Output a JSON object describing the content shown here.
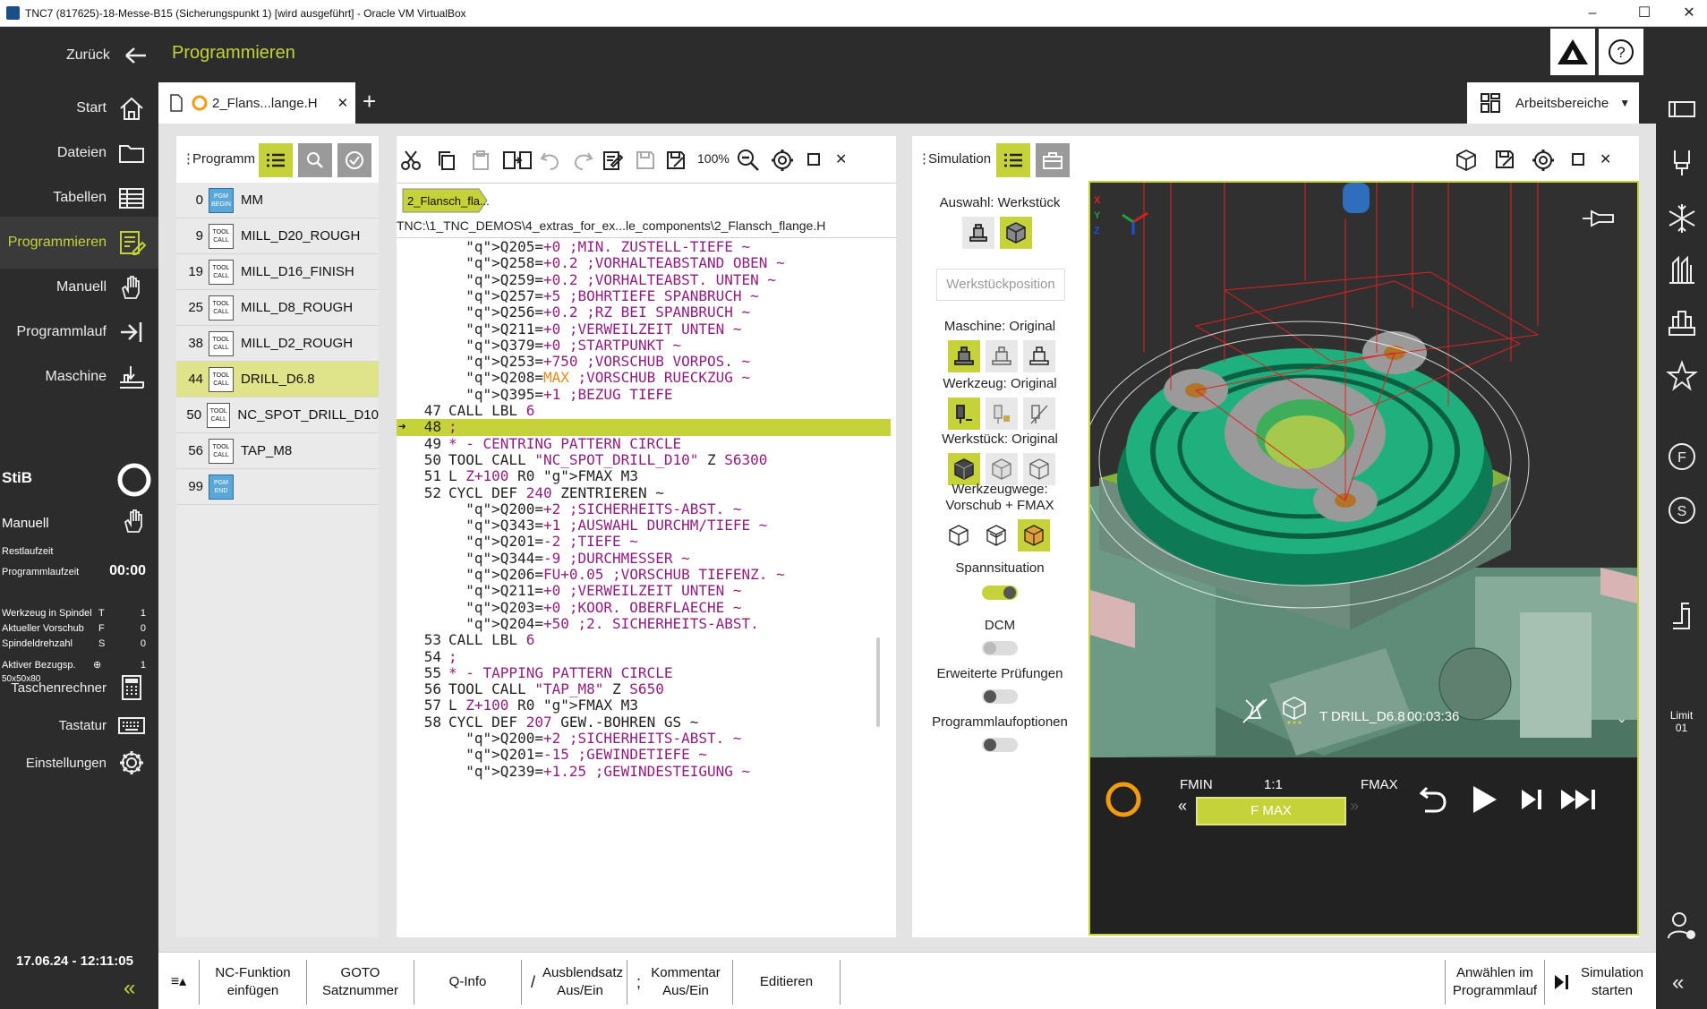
{
  "window": {
    "title": "TNC7 (817625)-18-Messe-B15 (Sicherungspunkt 1) [wird ausgeführt] - Oracle VM VirtualBox"
  },
  "header": {
    "back_label": "Zurück",
    "page_title": "Programmieren"
  },
  "nav": {
    "items": [
      {
        "label": "Start",
        "icon": "home-icon"
      },
      {
        "label": "Dateien",
        "icon": "folder-icon"
      },
      {
        "label": "Tabellen",
        "icon": "table-icon"
      },
      {
        "label": "Programmieren",
        "icon": "program-edit-icon",
        "active": true
      },
      {
        "label": "Manuell",
        "icon": "hand-icon"
      },
      {
        "label": "Programmlauf",
        "icon": "program-run-icon"
      },
      {
        "label": "Maschine",
        "icon": "machine-icon"
      }
    ],
    "stib_label": "StiB",
    "manuell_label": "Manuell",
    "restlaufzeit_label": "Restlaufzeit",
    "programmlaufzeit_label": "Programmlaufzeit",
    "programmlaufzeit_value": "00:00",
    "status": [
      {
        "label": "Werkzeug in Spindel",
        "sym": "T",
        "value": "1"
      },
      {
        "label": "Aktueller Vorschub",
        "sym": "F",
        "value": "0"
      },
      {
        "label": "Spindeldrehzahl",
        "sym": "S",
        "value": "0"
      }
    ],
    "bezug_label": "Aktiver Bezugsp.",
    "bezug_value": "1",
    "bezug_sub": "50x50x80",
    "taschenrechner_label": "Taschenrechner",
    "tastatur_label": "Tastatur",
    "einstellungen_label": "Einstellungen",
    "datetime": "17.06.24 - 12:11:05"
  },
  "tabs": {
    "file_tab": "2_Flans...lange.H",
    "add": "+",
    "arbeitsbereiche": "Arbeitsbereiche"
  },
  "program_panel": {
    "title": "Programm",
    "rows": [
      {
        "num": "0",
        "type": "PGM BEGIN",
        "name": "MM"
      },
      {
        "num": "9",
        "type": "TOOL CALL",
        "name": "MILL_D20_ROUGH"
      },
      {
        "num": "19",
        "type": "TOOL CALL",
        "name": "MILL_D16_FINISH"
      },
      {
        "num": "25",
        "type": "TOOL CALL",
        "name": "MILL_D8_ROUGH"
      },
      {
        "num": "38",
        "type": "TOOL CALL",
        "name": "MILL_D2_ROUGH"
      },
      {
        "num": "44",
        "type": "TOOL CALL",
        "name": "DRILL_D6.8",
        "selected": true
      },
      {
        "num": "50",
        "type": "TOOL CALL",
        "name": "NC_SPOT_DRILL_D10"
      },
      {
        "num": "56",
        "type": "TOOL CALL",
        "name": "TAP_M8"
      },
      {
        "num": "99",
        "type": "PGM END",
        "name": ""
      }
    ]
  },
  "editor": {
    "zoom": "100%",
    "breadcrumb": "2_Flansch_fla...",
    "path": "TNC:\\1_TNC_DEMOS\\4_extras_for_ex...le_components\\2_Flansch_flange.H",
    "lines": [
      {
        "n": "",
        "t": "  Q205=+0 ;MIN. ZUSTELL-TIEFE ~"
      },
      {
        "n": "",
        "t": "  Q258=+0.2 ;VORHALTEABSTAND OBEN ~"
      },
      {
        "n": "",
        "t": "  Q259=+0.2 ;VORHALTEABST. UNTEN ~"
      },
      {
        "n": "",
        "t": "  Q257=+5 ;BOHRTIEFE SPANBRUCH ~"
      },
      {
        "n": "",
        "t": "  Q256=+0.2 ;RZ BEI SPANBRUCH ~"
      },
      {
        "n": "",
        "t": "  Q211=+0 ;VERWEILZEIT UNTEN ~"
      },
      {
        "n": "",
        "t": "  Q379=+0 ;STARTPUNKT ~"
      },
      {
        "n": "",
        "t": "  Q253=+750 ;VORSCHUB VORPOS. ~"
      },
      {
        "n": "",
        "t": "  Q208=MAX ;VORSCHUB RUECKZUG ~"
      },
      {
        "n": "",
        "t": "  Q395=+1 ;BEZUG TIEFE"
      },
      {
        "n": "47",
        "t": "CALL LBL 6"
      },
      {
        "n": "48",
        "t": ";",
        "hl": true
      },
      {
        "n": "49",
        "t": "* - CENTRING PATTERN CIRCLE"
      },
      {
        "n": "50",
        "t": "TOOL CALL \"NC_SPOT_DRILL_D10\" Z S6300"
      },
      {
        "n": "51",
        "t": "L Z+100 R0 FMAX M3"
      },
      {
        "n": "52",
        "t": "CYCL DEF 240 ZENTRIEREN ~"
      },
      {
        "n": "",
        "t": "  Q200=+2 ;SICHERHEITS-ABST. ~"
      },
      {
        "n": "",
        "t": "  Q343=+1 ;AUSWAHL DURCHM/TIEFE ~"
      },
      {
        "n": "",
        "t": "  Q201=-2 ;TIEFE ~"
      },
      {
        "n": "",
        "t": "  Q344=-9 ;DURCHMESSER ~"
      },
      {
        "n": "",
        "t": "  Q206=FU+0.05 ;VORSCHUB TIEFENZ. ~"
      },
      {
        "n": "",
        "t": "  Q211=+0 ;VERWEILZEIT UNTEN ~"
      },
      {
        "n": "",
        "t": "  Q203=+0 ;KOOR. OBERFLAECHE ~"
      },
      {
        "n": "",
        "t": "  Q204=+50 ;2. SICHERHEITS-ABST."
      },
      {
        "n": "53",
        "t": "CALL LBL 6"
      },
      {
        "n": "54",
        "t": ";"
      },
      {
        "n": "55",
        "t": "* - TAPPING PATTERN CIRCLE"
      },
      {
        "n": "56",
        "t": "TOOL CALL \"TAP_M8\" Z S650"
      },
      {
        "n": "57",
        "t": "L Z+100 R0 FMAX M3"
      },
      {
        "n": "58",
        "t": "CYCL DEF 207 GEW.-BOHREN GS ~"
      },
      {
        "n": "",
        "t": "  Q200=+2 ;SICHERHEITS-ABST. ~"
      },
      {
        "n": "",
        "t": "  Q201=-15 ;GEWINDETIEFE ~"
      },
      {
        "n": "",
        "t": "  Q239=+1.25 ;GEWINDESTEIGUNG ~"
      }
    ]
  },
  "simulation": {
    "title": "Simulation",
    "auswahl": "Auswahl: Werkstück",
    "werkstueckposition": "Werkstückposition",
    "maschine": "Maschine: Original",
    "werkzeug": "Werkzeug: Original",
    "werkstueck": "Werkstück: Original",
    "werkzeugwege1": "Werkzeugwege:",
    "werkzeugwege2": "Vorschub + FMAX",
    "spannsituation": "Spannsituation",
    "dcm": "DCM",
    "erweiterte": "Erweiterte Prüfungen",
    "programmlaufoptionen": "Programmlaufoptionen",
    "tool_readout": "T DRILL_D6.8",
    "time_readout": "00:03:36",
    "axes": [
      "X",
      "Y",
      "Z"
    ],
    "fmin": "FMIN",
    "ratio": "1:1",
    "fmax": "FMAX",
    "speed_label": "F MAX",
    "speed_level": 1.0
  },
  "softkeys": [
    {
      "label": "NC-Funktion einfügen"
    },
    {
      "label": "GOTO Satznummer"
    },
    {
      "label": "Q-Info"
    },
    {
      "label": "Ausblendsatz Aus/Ein",
      "prefix": "/"
    },
    {
      "label": "Kommentar Aus/Ein",
      "prefix": ";"
    },
    {
      "label": "Editieren"
    },
    {
      "label": "Anwählen im Programmlauf"
    },
    {
      "label": "Simulation starten"
    }
  ],
  "right_bar": {
    "limit_label": "Limit",
    "limit_value": "01"
  },
  "colors": {
    "accent": "#c6d23a",
    "dark": "#2c2c2c",
    "comment": "#8e1e7e",
    "fmax": "#e0891a",
    "orange": "#f39c12"
  }
}
